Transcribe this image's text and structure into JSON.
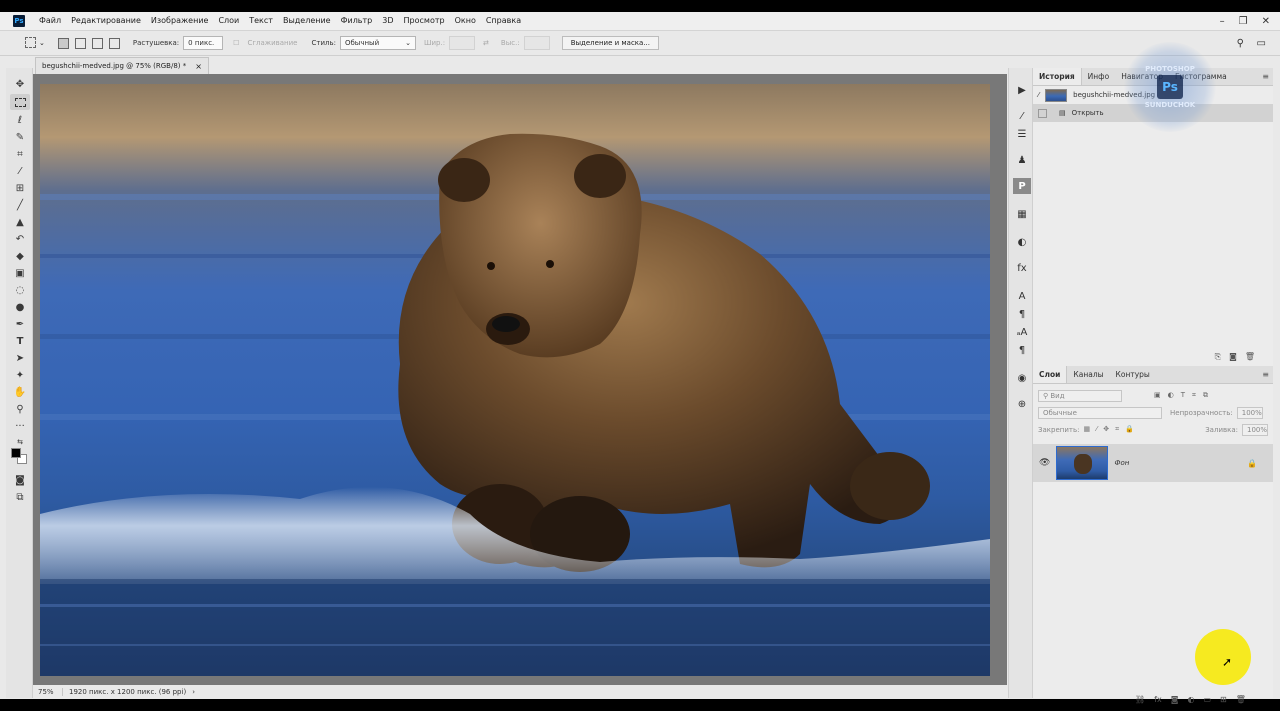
{
  "app": {
    "logo": "Ps"
  },
  "menu": [
    "Файл",
    "Редактирование",
    "Изображение",
    "Слои",
    "Текст",
    "Выделение",
    "Фильтр",
    "3D",
    "Просмотр",
    "Окно",
    "Справка"
  ],
  "window_controls": [
    "–",
    "❐",
    "✕"
  ],
  "options": {
    "feather_label": "Растушевка:",
    "feather_value": "0 пикс.",
    "antialias_label": "Сглаживание",
    "style_label": "Стиль:",
    "style_value": "Обычный",
    "width_label": "Шир.:",
    "height_label": "Выс.:",
    "select_mask_button": "Выделение и маска..."
  },
  "document": {
    "tab_title": "begushchii-medved.jpg @ 75% (RGB/8) *",
    "close": "×",
    "zoom": "75%",
    "info": "1920 пикс. x 1200 пикс. (96 ppi)"
  },
  "history_panel": {
    "tabs": [
      "История",
      "Инфо",
      "Навигатор",
      "Гистограмма"
    ],
    "snapshot_label": "begushchii-medved.jpg",
    "steps": [
      "Открыть"
    ]
  },
  "layers_panel": {
    "tabs": [
      "Слои",
      "Каналы",
      "Контуры"
    ],
    "filter_placeholder": "Вид",
    "blend_mode": "Обычные",
    "opacity_label": "Непрозрачность:",
    "opacity_value": "100%",
    "lock_label": "Закрепить:",
    "fill_label": "Заливка:",
    "fill_value": "100%",
    "layers": [
      {
        "name": "Фон",
        "visible": true,
        "locked": true
      }
    ]
  },
  "watermark": {
    "line1": "PHOTOSHOP",
    "logo": "Ps",
    "line2": "SUNDUCHOK"
  },
  "icons": {
    "tools": [
      "move-icon",
      "marquee-icon",
      "lasso-icon",
      "quick-select-icon",
      "crop-icon",
      "eyedropper-icon",
      "healing-icon",
      "brush-icon",
      "stamp-icon",
      "history-brush-icon",
      "eraser-icon",
      "gradient-icon",
      "blur-icon",
      "dodge-icon",
      "pen-icon",
      "type-icon",
      "path-select-icon",
      "shape-icon",
      "hand-icon",
      "zoom-icon",
      "more-icon"
    ],
    "dock": [
      "play-icon",
      "brush-settings-icon",
      "adjust-icon",
      "person-icon",
      "paragraph-p-icon",
      "grid-icon",
      "circle-half-icon",
      "style-icon",
      "type-a-icon",
      "paragraph-icon",
      "char-style-icon",
      "glyph-icon",
      "3d-icon",
      "layer-comps-icon"
    ]
  },
  "colors": {
    "foreground": "#000000",
    "background": "#ffffff",
    "accent": "#2d6bd0"
  }
}
